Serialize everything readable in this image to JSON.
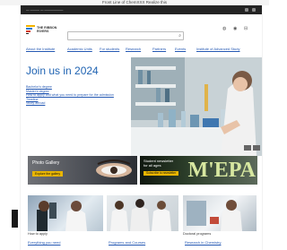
{
  "window": {
    "title": "Front Line of ChemXXX Realize this"
  },
  "topbar": {
    "text": "— ——— — ——————"
  },
  "header": {
    "logo_text_1": "THE RIBBON",
    "logo_text_2": "RIVERS",
    "search": {
      "placeholder": ""
    },
    "utility_icons": [
      "globe-icon",
      "user-icon",
      "share-icon"
    ]
  },
  "nav": {
    "items": [
      {
        "label": "About the Institute"
      },
      {
        "label": "Academic Units"
      },
      {
        "label": "For students"
      },
      {
        "label": "Research"
      },
      {
        "label": "Partners"
      },
      {
        "label": "Events"
      },
      {
        "label": "Institute of Advanced Study"
      }
    ]
  },
  "hero": {
    "title": "Join us in 2024",
    "links": [
      "Bachelor's degree",
      "Master's degree",
      "How to apply and what you need to prepare for the admission",
      "Timeline",
      "Study abroad"
    ]
  },
  "promos": [
    {
      "title": "Photo Gallery",
      "button": "Explore the gallery"
    },
    {
      "title_1": "Student newsletter",
      "title_2": "for all ages",
      "button": "Subscribe to newsletter",
      "big_text": "M'EPA"
    }
  ],
  "cards": [
    {
      "caption": "How to apply",
      "link": "Everything you need"
    },
    {
      "caption": "",
      "link": "Programs and Courses"
    },
    {
      "caption": "Doctoral programs",
      "link": "Research in Chemistry"
    }
  ],
  "colors": {
    "accent": "#1f63b2",
    "link": "#2458b3",
    "button": "#e9b500"
  }
}
